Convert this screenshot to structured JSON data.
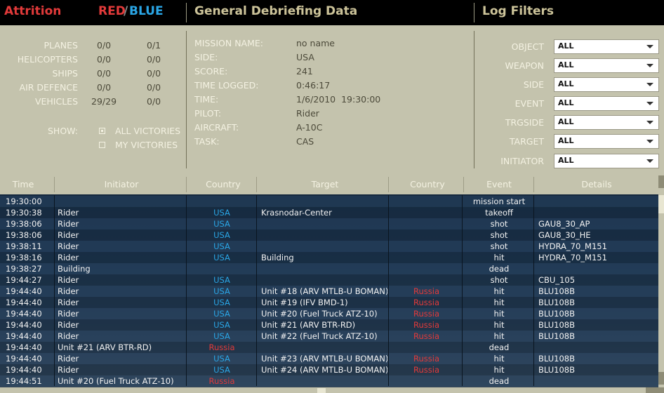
{
  "header": {
    "attrition": "Attrition",
    "red": "RED",
    "slash": "/",
    "blue": "BLUE",
    "general": "General Debriefing Data",
    "log_filters": "Log Filters"
  },
  "attrition": {
    "rows": [
      {
        "label": "PLANES",
        "red": "0/0",
        "blue": "0/1"
      },
      {
        "label": "HELICOPTERS",
        "red": "0/0",
        "blue": "0/0"
      },
      {
        "label": "SHIPS",
        "red": "0/0",
        "blue": "0/0"
      },
      {
        "label": "AIR DEFENCE",
        "red": "0/0",
        "blue": "0/0"
      },
      {
        "label": "VEHICLES",
        "red": "29/29",
        "blue": "0/0"
      }
    ],
    "show_label": "SHOW:",
    "all_victories": "ALL VICTORIES",
    "my_victories": "MY VICTORIES",
    "selected": "ALL VICTORIES"
  },
  "general": {
    "rows": [
      {
        "label": "MISSION NAME:",
        "value": "no name"
      },
      {
        "label": "SIDE:",
        "value": "USA"
      },
      {
        "label": "SCORE:",
        "value": "241"
      },
      {
        "label": "TIME LOGGED:",
        "value": "0:46:17"
      },
      {
        "label": "TIME:",
        "value": "1/6/2010  19:30:00"
      },
      {
        "label": "PILOT:",
        "value": "Rider"
      },
      {
        "label": "AIRCRAFT:",
        "value": "A-10C"
      },
      {
        "label": "TASK:",
        "value": "CAS"
      }
    ]
  },
  "filters": [
    {
      "label": "OBJECT",
      "value": "ALL"
    },
    {
      "label": "WEAPON",
      "value": "ALL"
    },
    {
      "label": "SIDE",
      "value": "ALL"
    },
    {
      "label": "EVENT",
      "value": "ALL"
    },
    {
      "label": "TRGSIDE",
      "value": "ALL"
    },
    {
      "label": "TARGET",
      "value": "ALL"
    },
    {
      "label": "INITIATOR",
      "value": "ALL"
    }
  ],
  "log": {
    "columns": [
      "Time",
      "Initiator",
      "Country",
      "Target",
      "Country",
      "Event",
      "Details"
    ],
    "rows": [
      [
        "19:30:00",
        "",
        "",
        "",
        "",
        "mission start",
        ""
      ],
      [
        "19:30:38",
        "Rider",
        "USA",
        "Krasnodar-Center",
        "",
        "takeoff",
        ""
      ],
      [
        "19:38:06",
        "Rider",
        "USA",
        "",
        "",
        "shot",
        "GAU8_30_AP"
      ],
      [
        "19:38:06",
        "Rider",
        "USA",
        "",
        "",
        "shot",
        "GAU8_30_HE"
      ],
      [
        "19:38:11",
        "Rider",
        "USA",
        "",
        "",
        "shot",
        "HYDRA_70_M151"
      ],
      [
        "19:38:16",
        "Rider",
        "USA",
        "Building",
        "",
        "hit",
        "HYDRA_70_M151"
      ],
      [
        "19:38:27",
        "Building",
        "",
        "",
        "",
        "dead",
        ""
      ],
      [
        "19:44:27",
        "Rider",
        "USA",
        "",
        "",
        "shot",
        "CBU_105"
      ],
      [
        "19:44:40",
        "Rider",
        "USA",
        "Unit #18 (ARV MTLB-U BOMAN)",
        "Russia",
        "hit",
        "BLU108B"
      ],
      [
        "19:44:40",
        "Rider",
        "USA",
        "Unit #19 (IFV BMD-1)",
        "Russia",
        "hit",
        "BLU108B"
      ],
      [
        "19:44:40",
        "Rider",
        "USA",
        "Unit #20 (Fuel Truck ATZ-10)",
        "Russia",
        "hit",
        "BLU108B"
      ],
      [
        "19:44:40",
        "Rider",
        "USA",
        "Unit #21 (ARV BTR-RD)",
        "Russia",
        "hit",
        "BLU108B"
      ],
      [
        "19:44:40",
        "Rider",
        "USA",
        "Unit #22 (Fuel Truck ATZ-10)",
        "Russia",
        "hit",
        "BLU108B"
      ],
      [
        "19:44:40",
        "Unit #21 (ARV BTR-RD)",
        "Russia",
        "",
        "",
        "dead",
        ""
      ],
      [
        "19:44:40",
        "Rider",
        "USA",
        "Unit #23 (ARV MTLB-U BOMAN)",
        "Russia",
        "hit",
        "BLU108B"
      ],
      [
        "19:44:40",
        "Rider",
        "USA",
        "Unit #24 (ARV MTLB-U BOMAN)",
        "Russia",
        "hit",
        "BLU108B"
      ],
      [
        "19:44:51",
        "Unit #20 (Fuel Truck ATZ-10)",
        "Russia",
        "",
        "",
        "dead",
        ""
      ]
    ]
  },
  "colors": {
    "red": "#e23a3a",
    "blue": "#2aa6e6",
    "title": "#cdc49a",
    "panel": "#c4c3ad"
  }
}
